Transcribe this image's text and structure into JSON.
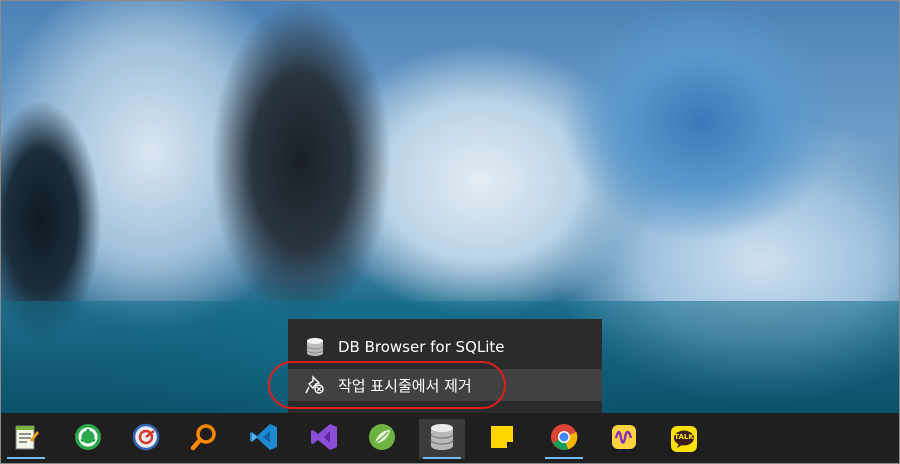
{
  "context_menu": {
    "app_item_label": "DB Browser for SQLite",
    "unpin_label": "작업 표시줄에서 제거"
  },
  "taskbar": {
    "icons": [
      {
        "name": "notepad-plus-icon",
        "running": true
      },
      {
        "name": "recycle-app-icon",
        "running": false
      },
      {
        "name": "screenshot-app-icon",
        "running": false
      },
      {
        "name": "search-magnifier-icon",
        "running": false
      },
      {
        "name": "vscode-icon",
        "running": false
      },
      {
        "name": "visual-studio-icon",
        "running": false
      },
      {
        "name": "spring-tool-icon",
        "running": false
      },
      {
        "name": "db-browser-sqlite-icon",
        "running": true,
        "active": true
      },
      {
        "name": "sticky-notes-icon",
        "running": false
      },
      {
        "name": "chrome-icon",
        "running": true
      },
      {
        "name": "audio-wave-app-icon",
        "running": false
      },
      {
        "name": "kakaotalk-icon",
        "running": false
      }
    ],
    "kakaotalk_label": "TALK"
  },
  "colors": {
    "taskbar": "#1f1f1f",
    "menu": "#2b2b2b",
    "running_indicator": "#76b9ed",
    "highlight_circle": "#d9201f"
  }
}
